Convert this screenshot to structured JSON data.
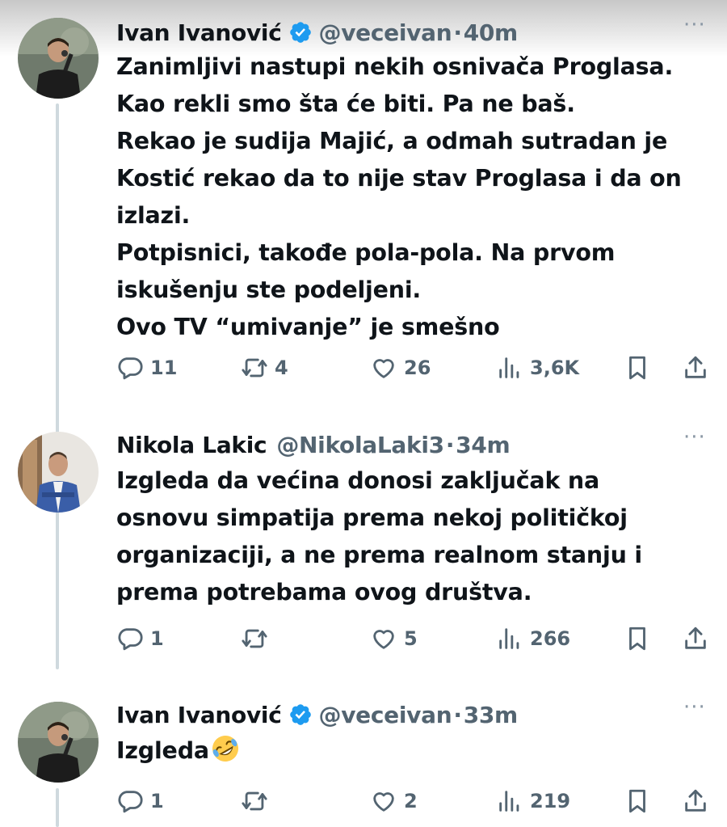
{
  "colors": {
    "text": "#0f1419",
    "muted": "#536471",
    "verified": "#1d9bf0",
    "line": "#cfd9de"
  },
  "tweets": [
    {
      "author": "Ivan Ivanović",
      "verified": true,
      "handle": "@veceivan",
      "separator": "·",
      "time": "40m",
      "more_icon": "more-horizontal-icon",
      "lines": [
        "Zanimljivi nastupi nekih osnivača Proglasa.",
        "Kao rekli smo šta će biti. Pa ne baš.",
        "Rekao je sudija Majić, a odmah sutradan je",
        "Kostić rekao da to nije stav Proglasa i da on",
        "izlazi.",
        "Potpisnici, takođe pola-pola. Na prvom",
        "iskušenju ste podeljeni.",
        "Ovo TV “umivanje” je smešno"
      ],
      "stats": {
        "replies": "11",
        "reposts": "4",
        "likes": "26",
        "views": "3,6K"
      }
    },
    {
      "author": "Nikola Lakic",
      "verified": false,
      "handle": "@NikolaLaki3",
      "separator": "·",
      "time": "34m",
      "lines": [
        "Izgleda da većina donosi zaključak na",
        "osnovu simpatija prema nekoj političkoj",
        "organizaciji, a ne prema realnom stanju i",
        "prema potrebama ovog društva."
      ],
      "stats": {
        "replies": "1",
        "reposts": "",
        "likes": "5",
        "views": "266"
      }
    },
    {
      "author": "Ivan Ivanović",
      "verified": true,
      "handle": "@veceivan",
      "separator": "·",
      "time": "33m",
      "lines": [
        "Izgleda"
      ],
      "emoji": "rolling-on-floor-laughing-emoji",
      "stats": {
        "replies": "1",
        "reposts": "",
        "likes": "2",
        "views": "219"
      }
    }
  ]
}
